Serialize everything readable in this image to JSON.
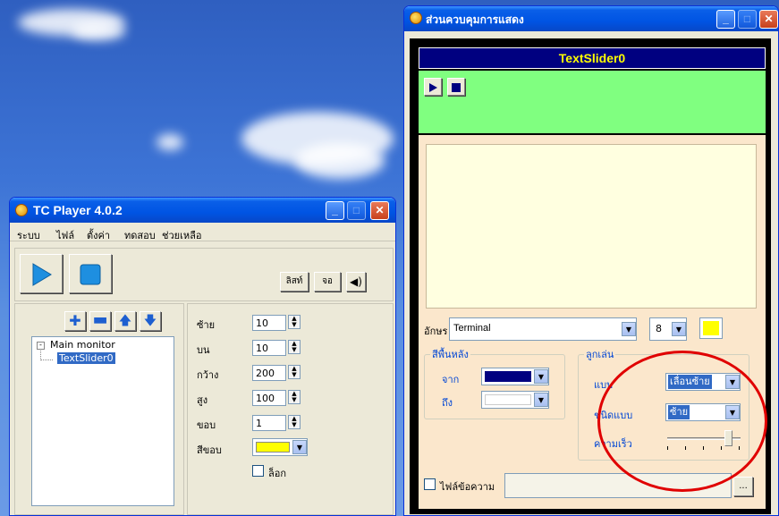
{
  "player": {
    "title": "TC Player  4.0.2",
    "menu": [
      "ระบบ",
      "ไฟล์",
      "ตั้งค่า",
      "ทดสอบ",
      "ช่วยเหลือ"
    ],
    "list_button": "ลิสท์",
    "screen_button": "จอ",
    "tree": {
      "root": "Main monitor",
      "child": "TextSlider0"
    },
    "props": {
      "left_label": "ซ้าย",
      "left_value": "10",
      "top_label": "บน",
      "top_value": "10",
      "width_label": "กว้าง",
      "width_value": "200",
      "height_label": "สูง",
      "height_value": "100",
      "border_label": "ขอบ",
      "border_value": "1",
      "border_color_label": "สีขอบ",
      "border_color": "#ffff00",
      "lock_label": "ล็อก"
    }
  },
  "control": {
    "title": "ส่วนควบคุมการแสดง",
    "header_name": "TextSlider0",
    "font_label": "อักษร",
    "font_value": "Terminal",
    "font_size": "8",
    "font_color": "#ffff00",
    "bg_legend": "สีพื้นหลัง",
    "bg_from_label": "จาก",
    "bg_from_color": "#000080",
    "bg_to_label": "ถึง",
    "bg_to_color": "#ffffff",
    "effect_legend": "ลูกเล่น",
    "type_label": "แบบ",
    "type_value": "เลื่อนซ้าย",
    "subtype_label": "ชนิดแบบ",
    "subtype_value": "ซ้าย",
    "speed_label": "ความเร็ว",
    "speed": 0.88,
    "file_label": "ไฟล์ข้อความ",
    "browse_button": "..."
  }
}
